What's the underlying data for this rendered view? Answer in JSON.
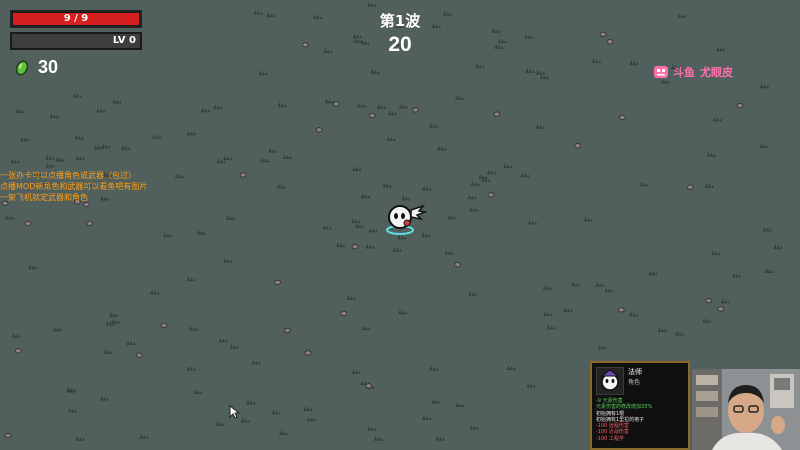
{
  "hud": {
    "health_text": "9 / 9",
    "level_text": "LV 0",
    "materials": "30",
    "wave_title": "第1波",
    "wave_timer": "20"
  },
  "notice": [
    "一张办卡可以点播角色或武器（包过）",
    "点播MOD新角色和武器可以看鱼吧有图片",
    "一架飞机就定武器和角色"
  ],
  "watermark": {
    "platform": "斗鱼",
    "name": "尤眼皮"
  },
  "card": {
    "name": "法师",
    "type": "角色",
    "stats": [
      {
        "text": "-9 元素伤害",
        "color": "g"
      },
      {
        "text": "元素伤害的修改增加33%",
        "color": "g"
      },
      {
        "text": "初始拥有1根",
        "color": "w"
      },
      {
        "text": "初始拥有1里拉的孢子",
        "color": "w"
      },
      {
        "text": "-100 远程伤害",
        "color": "r"
      },
      {
        "text": "-100 近战伤害",
        "color": "r"
      },
      {
        "text": "-100 工程学",
        "color": "r"
      }
    ]
  },
  "colors": {
    "ground": "#52605d",
    "health": "#d61f1f",
    "notice": "#ff9e12",
    "watermark": "#ff6fae"
  }
}
